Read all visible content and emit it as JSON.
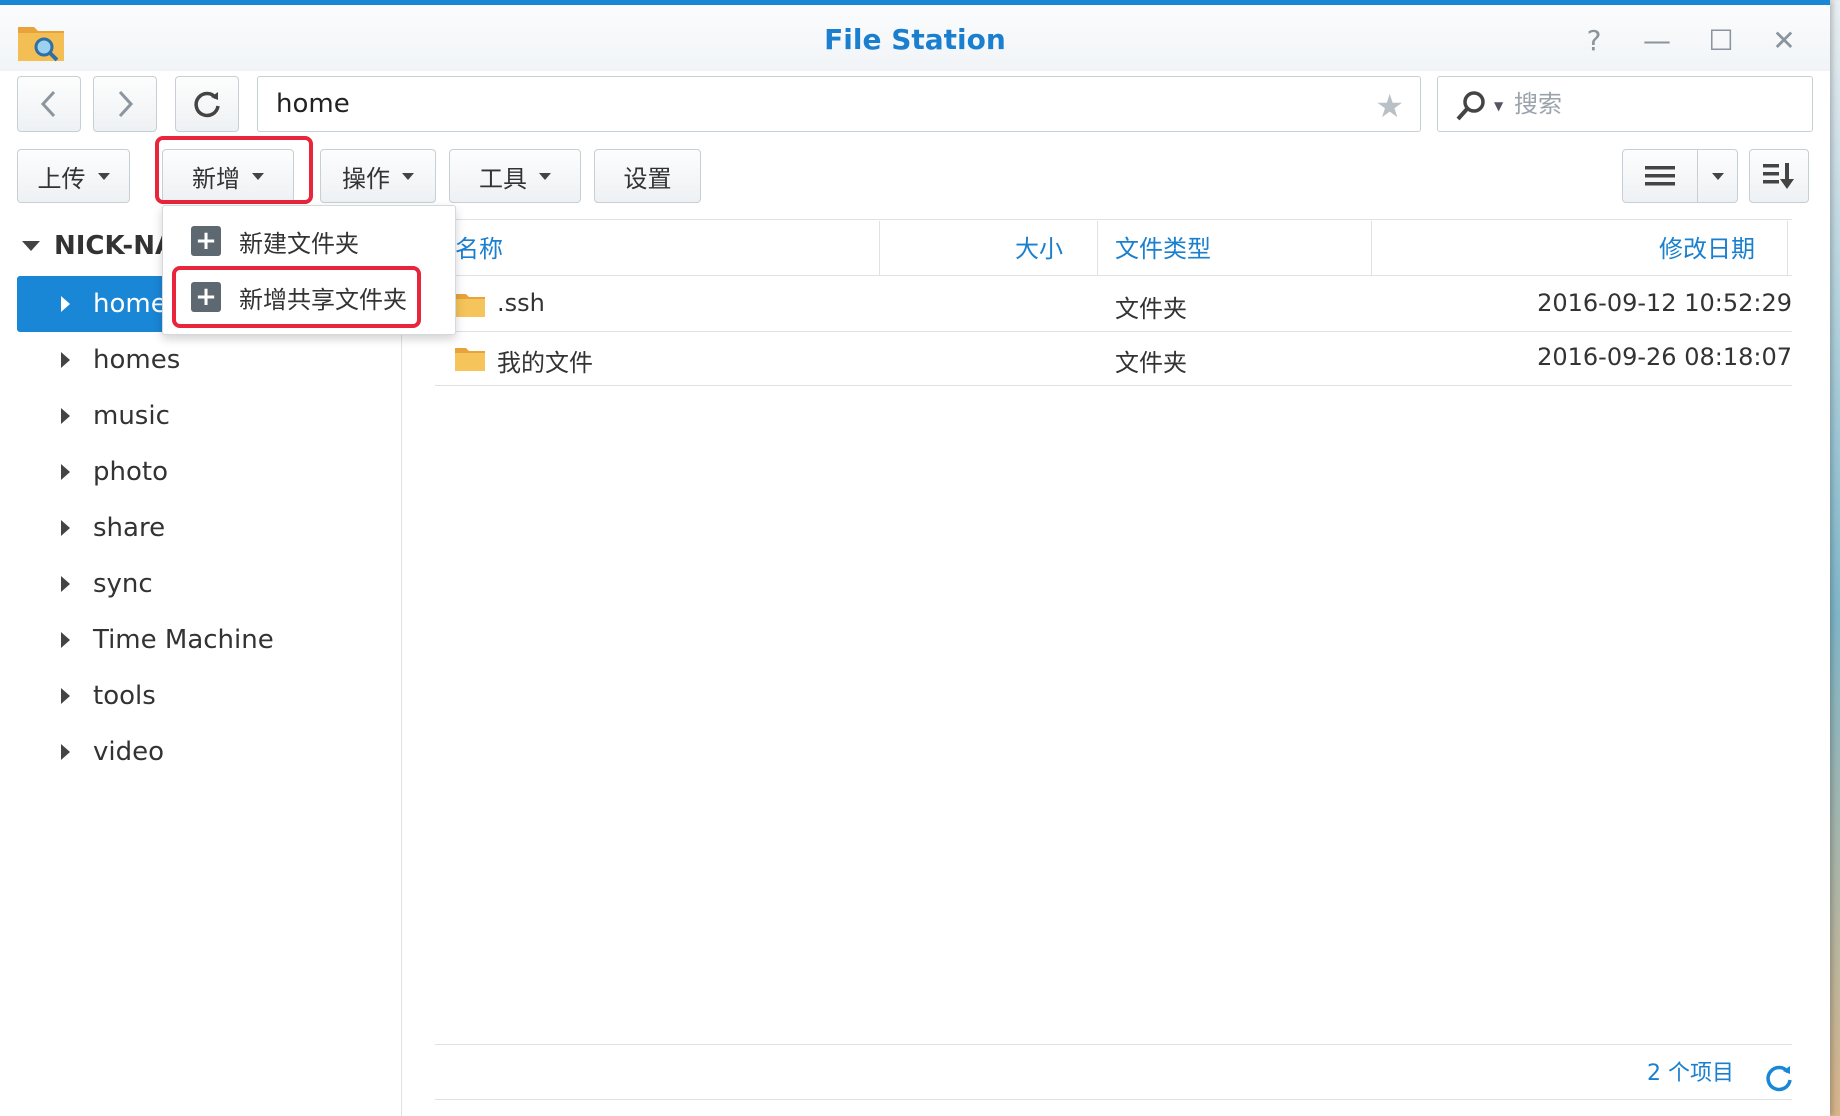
{
  "window": {
    "title": "File Station",
    "controls": {
      "help": "?",
      "minimize": "—",
      "maximize": "☐",
      "close": "✕"
    }
  },
  "nav": {
    "path": "home",
    "search_placeholder": "搜索"
  },
  "toolbar": {
    "upload": "上传",
    "create": "新增",
    "action": "操作",
    "tools": "工具",
    "settings": "设置"
  },
  "create_menu": {
    "items": [
      {
        "label": "新建文件夹"
      },
      {
        "label": "新增共享文件夹"
      }
    ]
  },
  "sidebar": {
    "root": "NICK-NA",
    "items": [
      {
        "label": "home"
      },
      {
        "label": "homes"
      },
      {
        "label": "music"
      },
      {
        "label": "photo"
      },
      {
        "label": "share"
      },
      {
        "label": "sync"
      },
      {
        "label": "Time Machine"
      },
      {
        "label": "tools"
      },
      {
        "label": "video"
      }
    ]
  },
  "columns": {
    "name": "名称",
    "size": "大小",
    "type": "文件类型",
    "modified": "修改日期"
  },
  "files": [
    {
      "name": ".ssh",
      "size": "",
      "type": "文件夹",
      "modified": "2016-09-12 10:52:29"
    },
    {
      "name": "我的文件",
      "size": "",
      "type": "文件夹",
      "modified": "2016-09-26 08:18:07"
    }
  ],
  "status": {
    "count_text": "2 个项目"
  },
  "colors": {
    "accent": "#1a86d6",
    "highlight": "#e8253b"
  }
}
